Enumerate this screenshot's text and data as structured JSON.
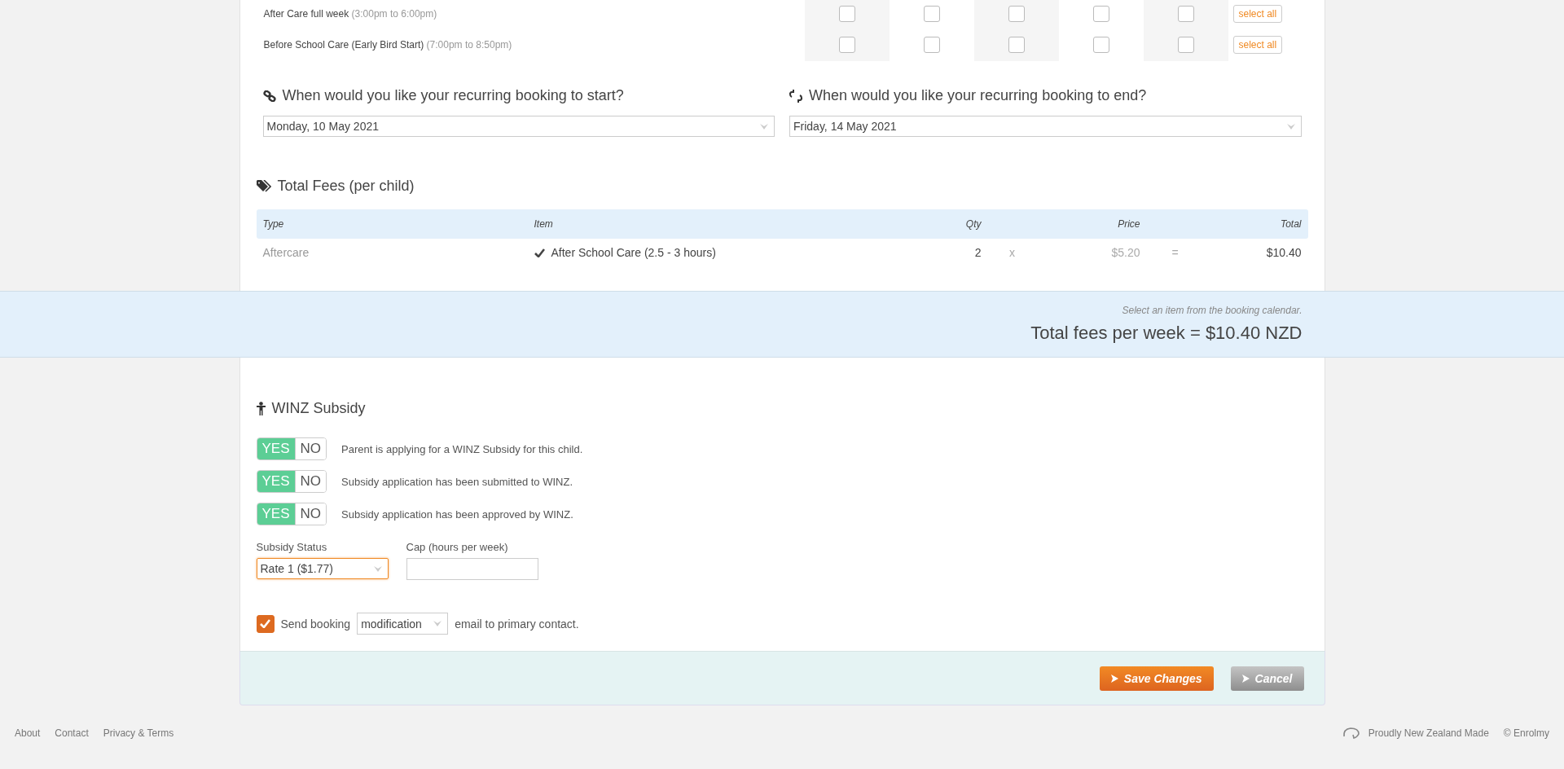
{
  "schedule_rows": [
    {
      "label": "After Care full week",
      "time": "(3:00pm to 6:00pm)",
      "days": [
        {
          "checked": false
        },
        {
          "checked": false
        },
        {
          "checked": false
        },
        {
          "checked": false
        },
        {
          "checked": false
        }
      ],
      "select_all": "select all"
    },
    {
      "label": "Before School Care (Early Bird Start)",
      "time": "(7:00pm to 8:50pm)",
      "days": [
        {
          "checked": false
        },
        {
          "checked": false
        },
        {
          "checked": false
        },
        {
          "checked": false
        },
        {
          "checked": false
        }
      ],
      "select_all": "select all"
    }
  ],
  "start": {
    "question": "When would you like your recurring booking to start?",
    "value": "Monday, 10 May 2021"
  },
  "end": {
    "question": "When would you like your recurring booking to end?",
    "value": "Friday, 14 May 2021"
  },
  "fees": {
    "title": "Total Fees (per child)",
    "columns": [
      "Type",
      "Item",
      "Qty",
      "Price",
      "Total"
    ],
    "rows": [
      {
        "type": "Aftercare",
        "item": "After School Care (2.5 - 3 hours)",
        "qty": "2",
        "times": "x",
        "price": "$5.20",
        "equals": "=",
        "total": "$10.40"
      }
    ]
  },
  "summary": {
    "hint": "Select an item from the booking calendar.",
    "total": "Total fees per week = $10.40 NZD"
  },
  "winz": {
    "title": "WINZ Subsidy",
    "questions": [
      {
        "options": [
          {
            "label": "YES",
            "selected": true
          },
          {
            "label": "NO",
            "selected": false
          }
        ],
        "text": "Parent is applying for a WINZ Subsidy for this child."
      },
      {
        "options": [
          {
            "label": "YES",
            "selected": true
          },
          {
            "label": "NO",
            "selected": false
          }
        ],
        "text": "Subsidy application has been submitted to WINZ."
      },
      {
        "options": [
          {
            "label": "YES",
            "selected": true
          },
          {
            "label": "NO",
            "selected": false
          }
        ],
        "text": "Subsidy application has been approved by WINZ."
      }
    ],
    "status_label": "Subsidy Status",
    "status_value": "Rate 1 ($1.77)",
    "cap_label": "Cap (hours per week)"
  },
  "send_email": {
    "checked": true,
    "before": "Send booking",
    "type": "modification",
    "after": "email to primary contact."
  },
  "buttons": [
    {
      "kind": "primary",
      "label": "Save Changes"
    },
    {
      "kind": "secondary",
      "label": "Cancel"
    }
  ],
  "footer": {
    "links": [
      "About",
      "Contact",
      "Privacy & Terms"
    ],
    "made": "Proudly New Zealand Made",
    "copyright": "© Enrolmy"
  }
}
